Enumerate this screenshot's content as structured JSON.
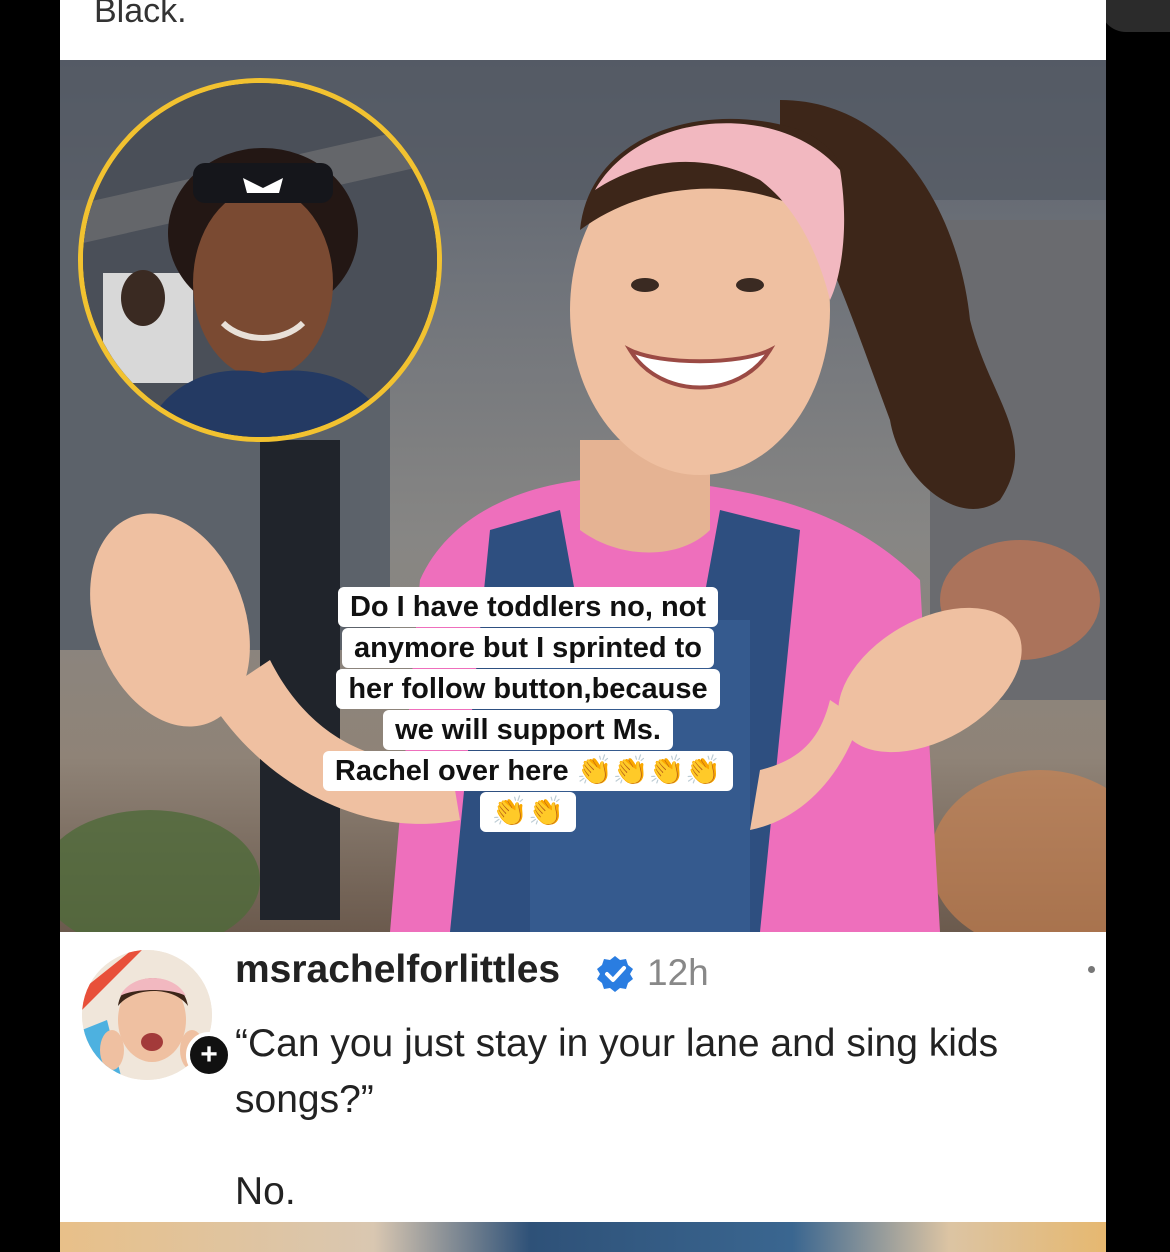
{
  "top_text": "Black.",
  "overlay": {
    "lines": [
      "Do I have toddlers no, not",
      "anymore but I sprinted to",
      "her follow button,because",
      "we will support Ms.",
      "Rachel over here 👏👏👏👏",
      "👏👏"
    ]
  },
  "post": {
    "username": "msrachelforlittles",
    "time": "12h",
    "caption": "“Can you just stay in your lane and sing kids songs?”",
    "reply": "No.",
    "follow_icon": "plus-icon",
    "verified_icon": "verified-check-icon",
    "verified_color": "#2a7de1"
  },
  "colors": {
    "inset_border": "#f2c230",
    "headband": "#f2b8c0",
    "shirt": "#ee6fbc",
    "overalls": "#2e4f80"
  }
}
